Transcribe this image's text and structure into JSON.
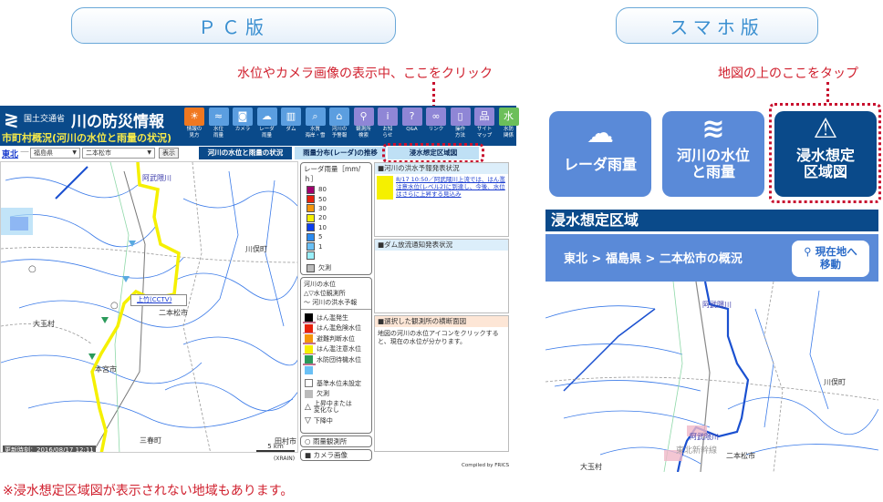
{
  "headers": {
    "pc_label": "ＰＣ版",
    "sp_label": "スマホ版",
    "pc_callout": "水位やカメラ画像の表示中、ここをクリック",
    "sp_callout": "地図の上のここをタップ"
  },
  "pc": {
    "ministry": "国土交通省",
    "site_title": "川の防災情報",
    "subtitle": "市町村概況(河川の水位と雨量の状況)",
    "nav": [
      {
        "label": "情報の\n見方",
        "icon": "lightbulb-icon",
        "glyph": "☀"
      },
      {
        "label": "水位\n雨量",
        "icon": "water-gauge-icon",
        "glyph": "≈"
      },
      {
        "label": "カメラ",
        "icon": "camera-icon",
        "glyph": "◙"
      },
      {
        "label": "レーダ\n雨量",
        "icon": "rain-cloud-icon",
        "glyph": "☁"
      },
      {
        "label": "ダム",
        "icon": "dam-icon",
        "glyph": "▥"
      },
      {
        "label": "水質\n海岸・雪",
        "icon": "water-quality-icon",
        "glyph": "⌕"
      },
      {
        "label": "河川の\n予警報",
        "icon": "house-flood-icon",
        "glyph": "⌂"
      },
      {
        "label": "観測所\n検索",
        "icon": "search-icon",
        "glyph": "⚲"
      },
      {
        "label": "お知\nらせ",
        "icon": "info-icon",
        "glyph": "i"
      },
      {
        "label": "Q&A",
        "icon": "question-icon",
        "glyph": "?"
      },
      {
        "label": "リンク",
        "icon": "link-icon",
        "glyph": "∞"
      },
      {
        "label": "操作\n方法",
        "icon": "mouse-icon",
        "glyph": "▯"
      },
      {
        "label": "サイト\nマップ",
        "icon": "sitemap-icon",
        "glyph": "品"
      },
      {
        "label": "水防\n関係",
        "icon": "flood-defense-icon",
        "glyph": "水"
      }
    ],
    "region_link": "東北",
    "region_sep": "—",
    "prefecture": "福島県",
    "city": "二本松市",
    "show_button": "表示",
    "tabs": [
      "河川の水位と雨量の状況",
      "雨量分布(レーダ)の推移",
      "浸水想定区域図"
    ],
    "map": {
      "labels": {
        "river_north": "阿武隈川",
        "kawamata": "川俣町",
        "otama": "大玉村",
        "nihonmatsu": "二本松市",
        "motomiya": "本宮市",
        "miharu": "三春町",
        "tamura": "田村市",
        "abukuma_rail": "阿武隈川"
      },
      "popup": "上竹(CCTV)",
      "update_time": "更新時刻：2016/08/17 12:11",
      "scale": "5 km",
      "source": "(XRAIN)"
    },
    "legend": {
      "radar_title": "レーダ雨量［mm/ｈ］",
      "radar_levels": [
        {
          "label": "80",
          "color": "#a0006e"
        },
        {
          "label": "50",
          "color": "#e8220c"
        },
        {
          "label": "30",
          "color": "#f5960a"
        },
        {
          "label": "20",
          "color": "#f5f000"
        },
        {
          "label": "10",
          "color": "#0a3ef0"
        },
        {
          "label": "5",
          "color": "#2a8af0"
        },
        {
          "label": "1",
          "color": "#6ac0f5"
        },
        {
          "label": "",
          "color": "#9af0fa"
        }
      ],
      "radar_missing": "欠測",
      "river_title": "河川の水位",
      "station_label": "△▽水位観測所",
      "forecast_label": "〜 河川の洪水予報",
      "levels": [
        {
          "label": "はん濫発生",
          "color": "#000000"
        },
        {
          "label": "はん濫危険水位",
          "color": "#e8220c"
        },
        {
          "label": "避難判断水位",
          "color": "#f5960a"
        },
        {
          "label": "はん濫注意水位",
          "color": "#f5f000"
        },
        {
          "label": "水防団待機水位",
          "color": "#2a9a5a"
        },
        {
          "label": "",
          "color": "#6ac0f5"
        }
      ],
      "unset": "基準水位未設定",
      "missing": "欠測",
      "rising": "上昇中または\n変化なし",
      "falling": "下降中",
      "rain_station": "雨量観測所",
      "camera": "カメラ画像"
    },
    "panels": {
      "flood_title": "■河川の洪水予報発表状況",
      "flood_item": "8/17 10:50／阿武隈川上流では、はん濫注意水位(レベル2)に到達し、今後、水位はさらに上昇する見込み",
      "dam_title": "■ダム放流通知発表状況",
      "cross_title": "■選択した観測所の横断面図",
      "cross_text": "地図の河川の水位アイコンをクリックすると、現在の水位が分かります。"
    },
    "compiled": "Compiled by FRICS"
  },
  "sp": {
    "buttons": [
      {
        "label": "レーダ雨量",
        "icon": "rain-cloud-icon"
      },
      {
        "label": "河川の水位\nと雨量",
        "icon": "water-gauge-icon"
      },
      {
        "label": "浸水想定\n区域図",
        "icon": "flood-map-warning-icon"
      }
    ],
    "section_title": "浸水想定区域",
    "breadcrumb": "東北 > 福島県 > 二本松市の概況",
    "locate_button": "現在地へ\n移動",
    "map_labels": {
      "river_north": "阿武隈川",
      "river_south": "阿武隈川",
      "shinkansen": "東北新幹線",
      "kawamata": "川俣町",
      "nihonmatsu": "二本松市",
      "otama": "大玉村"
    }
  },
  "footnote": "※浸水想定区域図が表示されない地域もあります。"
}
